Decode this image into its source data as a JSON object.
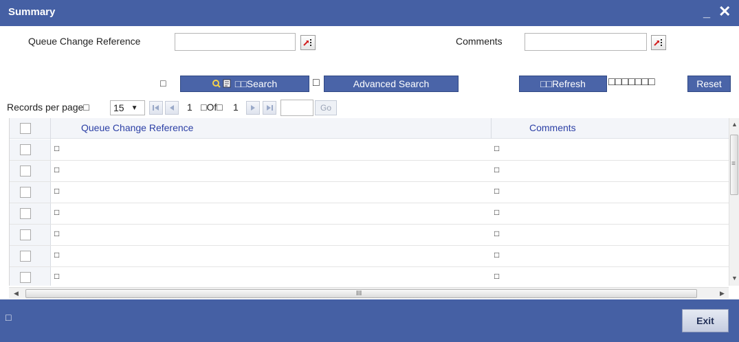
{
  "window": {
    "title": "Summary",
    "minimize_glyph": "_",
    "close_glyph": "✕"
  },
  "criteria": {
    "queue_ref_label": "Queue Change Reference",
    "queue_ref_value": "",
    "comments_label": "Comments",
    "comments_value": ""
  },
  "toolbar": {
    "search_leading_glyph": "□",
    "search_label": "Search",
    "search_prefix_glyphs": "□□",
    "advanced_prefix_glyph": "□",
    "advanced_search_label": "Advanced Search",
    "refresh_label": "□□Refresh",
    "reset_prefix_glyphs": "□□□□□□□",
    "reset_label": "Reset"
  },
  "pager": {
    "records_per_page_label": "Records per page□",
    "page_size": "15",
    "current_page": "1",
    "of_label": "□Of□",
    "total_pages": "1",
    "go_label": "Go"
  },
  "grid": {
    "columns": [
      "Queue Change Reference",
      "Comments"
    ],
    "rows": [
      {
        "ref": "□",
        "comments": "□"
      },
      {
        "ref": "□",
        "comments": "□"
      },
      {
        "ref": "□",
        "comments": "□"
      },
      {
        "ref": "□",
        "comments": "□"
      },
      {
        "ref": "□",
        "comments": "□"
      },
      {
        "ref": "□",
        "comments": "□"
      },
      {
        "ref": "□",
        "comments": "□"
      }
    ]
  },
  "scroll": {
    "h_thumb_grip": "III",
    "v_thumb_grip": "≡"
  },
  "footer": {
    "glyph": "□",
    "exit_label": "Exit"
  },
  "colors": {
    "titlebar": "#4560a4",
    "button": "#4a64a8",
    "column_header_text": "#2b3fa5"
  },
  "icons": {
    "lov": "list-of-values-icon",
    "search": "search-icon",
    "first": "first-page-icon",
    "prev": "previous-page-icon",
    "next": "next-page-icon",
    "last": "last-page-icon"
  }
}
